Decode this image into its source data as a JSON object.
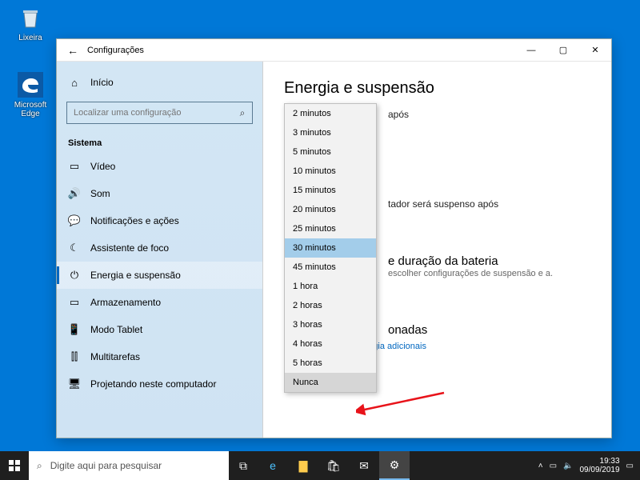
{
  "desktop": {
    "recycle": "Lixeira",
    "edge": "Microsoft Edge"
  },
  "window": {
    "title": "Configurações",
    "home": "Início",
    "search_placeholder": "Localizar uma configuração",
    "category": "Sistema",
    "items": [
      {
        "icon": "▭",
        "label": "Vídeo"
      },
      {
        "icon": "🔊",
        "label": "Som"
      },
      {
        "icon": "💬",
        "label": "Notificações e ações"
      },
      {
        "icon": "☾",
        "label": "Assistente de foco"
      },
      {
        "icon": "⏻",
        "label": "Energia e suspensão"
      },
      {
        "icon": "▭",
        "label": "Armazenamento"
      },
      {
        "icon": "📱",
        "label": "Modo Tablet"
      },
      {
        "icon": "⫿⫿",
        "label": "Multitarefas"
      },
      {
        "icon": "🖥",
        "label": "Projetando neste computador"
      }
    ],
    "active_index": 4
  },
  "content": {
    "heading": "Energia e suspensão",
    "line1_tail": "após",
    "line2_tail": "tador será suspenso após",
    "battery_heading": "e duração da bateria",
    "battery_desc": "escolher configurações de suspensão e a.",
    "related_tail": "onadas",
    "link": "Configurações de energia adicionais"
  },
  "dropdown": {
    "options": [
      "2 minutos",
      "3 minutos",
      "5 minutos",
      "10 minutos",
      "15 minutos",
      "20 minutos",
      "25 minutos",
      "30 minutos",
      "45 minutos",
      "1 hora",
      "2 horas",
      "3 horas",
      "4 horas",
      "5 horas",
      "Nunca"
    ],
    "selected_index": 7,
    "hover_index": 14
  },
  "taskbar": {
    "search_placeholder": "Digite aqui para pesquisar",
    "time": "19:33",
    "date": "09/09/2019"
  }
}
